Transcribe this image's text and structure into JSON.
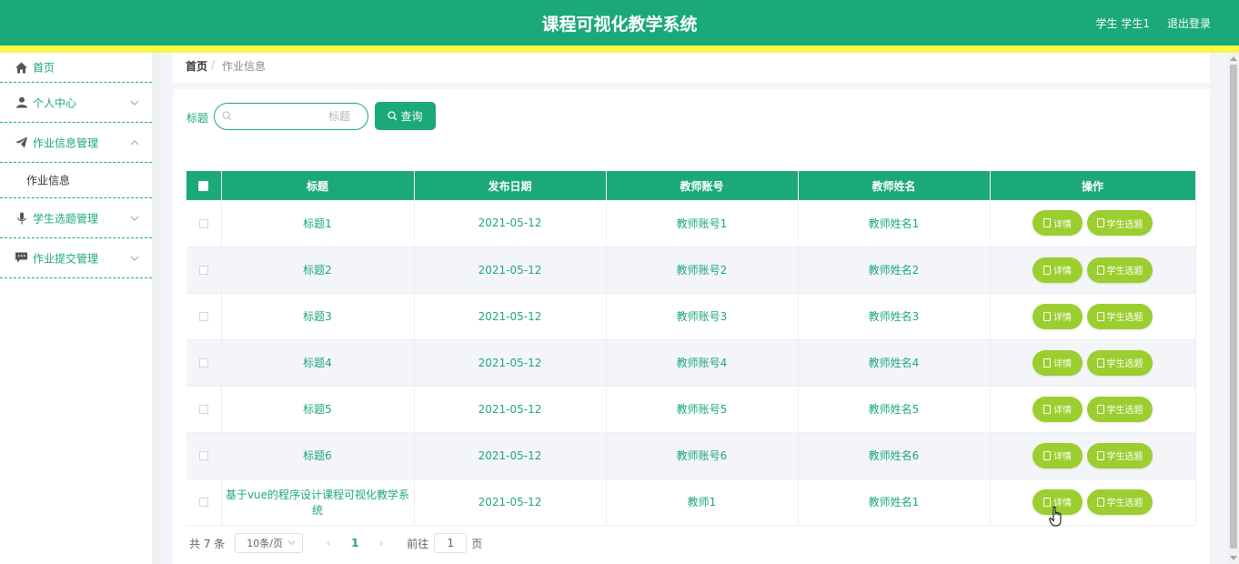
{
  "header": {
    "title": "课程可视化教学系统",
    "user": "学生 学生1",
    "logout": "退出登录"
  },
  "sidebar": {
    "items": [
      {
        "label": "首页",
        "icon": "home-icon"
      },
      {
        "label": "个人中心",
        "icon": "user-icon"
      },
      {
        "label": "作业信息管理",
        "icon": "send-icon",
        "expanded": true,
        "children": [
          "作业信息"
        ]
      },
      {
        "label": "学生选题管理",
        "icon": "microphone-icon"
      },
      {
        "label": "作业提交管理",
        "icon": "chat-icon"
      }
    ]
  },
  "breadcrumb": {
    "home": "首页",
    "separator": "/",
    "current": "作业信息"
  },
  "search": {
    "label": "标题",
    "placeholder": "标题",
    "button": "查询"
  },
  "table": {
    "columns": [
      "标题",
      "发布日期",
      "教师账号",
      "教师姓名",
      "操作"
    ],
    "rows": [
      {
        "title": "标题1",
        "date": "2021-05-12",
        "account": "教师账号1",
        "name": "教师姓名1"
      },
      {
        "title": "标题2",
        "date": "2021-05-12",
        "account": "教师账号2",
        "name": "教师姓名2"
      },
      {
        "title": "标题3",
        "date": "2021-05-12",
        "account": "教师账号3",
        "name": "教师姓名3"
      },
      {
        "title": "标题4",
        "date": "2021-05-12",
        "account": "教师账号4",
        "name": "教师姓名4"
      },
      {
        "title": "标题5",
        "date": "2021-05-12",
        "account": "教师账号5",
        "name": "教师姓名5"
      },
      {
        "title": "标题6",
        "date": "2021-05-12",
        "account": "教师账号6",
        "name": "教师姓名6"
      },
      {
        "title": "基于vue的程序设计课程可视化教学系统",
        "date": "2021-05-12",
        "account": "教师1",
        "name": "教师姓名1"
      }
    ],
    "actions": {
      "detail": "详情",
      "select": "学生选题"
    }
  },
  "pagination": {
    "total": "共 7 条",
    "page_size": "10条/页",
    "current_page": "1",
    "goto_label": "前往",
    "goto_value": "1",
    "page_suffix": "页"
  },
  "colors": {
    "primary": "#1ba87a",
    "accent_stripe": "#f8f84a",
    "action_button": "#9bce2e"
  }
}
